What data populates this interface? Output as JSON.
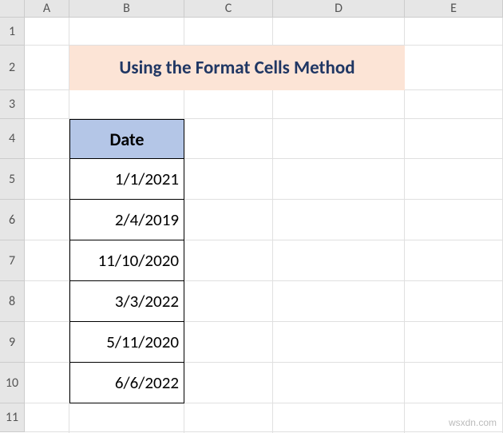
{
  "columns": [
    "A",
    "B",
    "C",
    "D",
    "E"
  ],
  "rows": [
    "1",
    "2",
    "3",
    "4",
    "5",
    "6",
    "7",
    "8",
    "9",
    "10",
    "11"
  ],
  "title": "Using the Format Cells Method",
  "table": {
    "header": "Date",
    "dates": [
      "1/1/2021",
      "2/4/2019",
      "11/10/2020",
      "3/3/2022",
      "5/11/2020",
      "6/6/2022"
    ]
  },
  "watermark": "wsxdn.com"
}
